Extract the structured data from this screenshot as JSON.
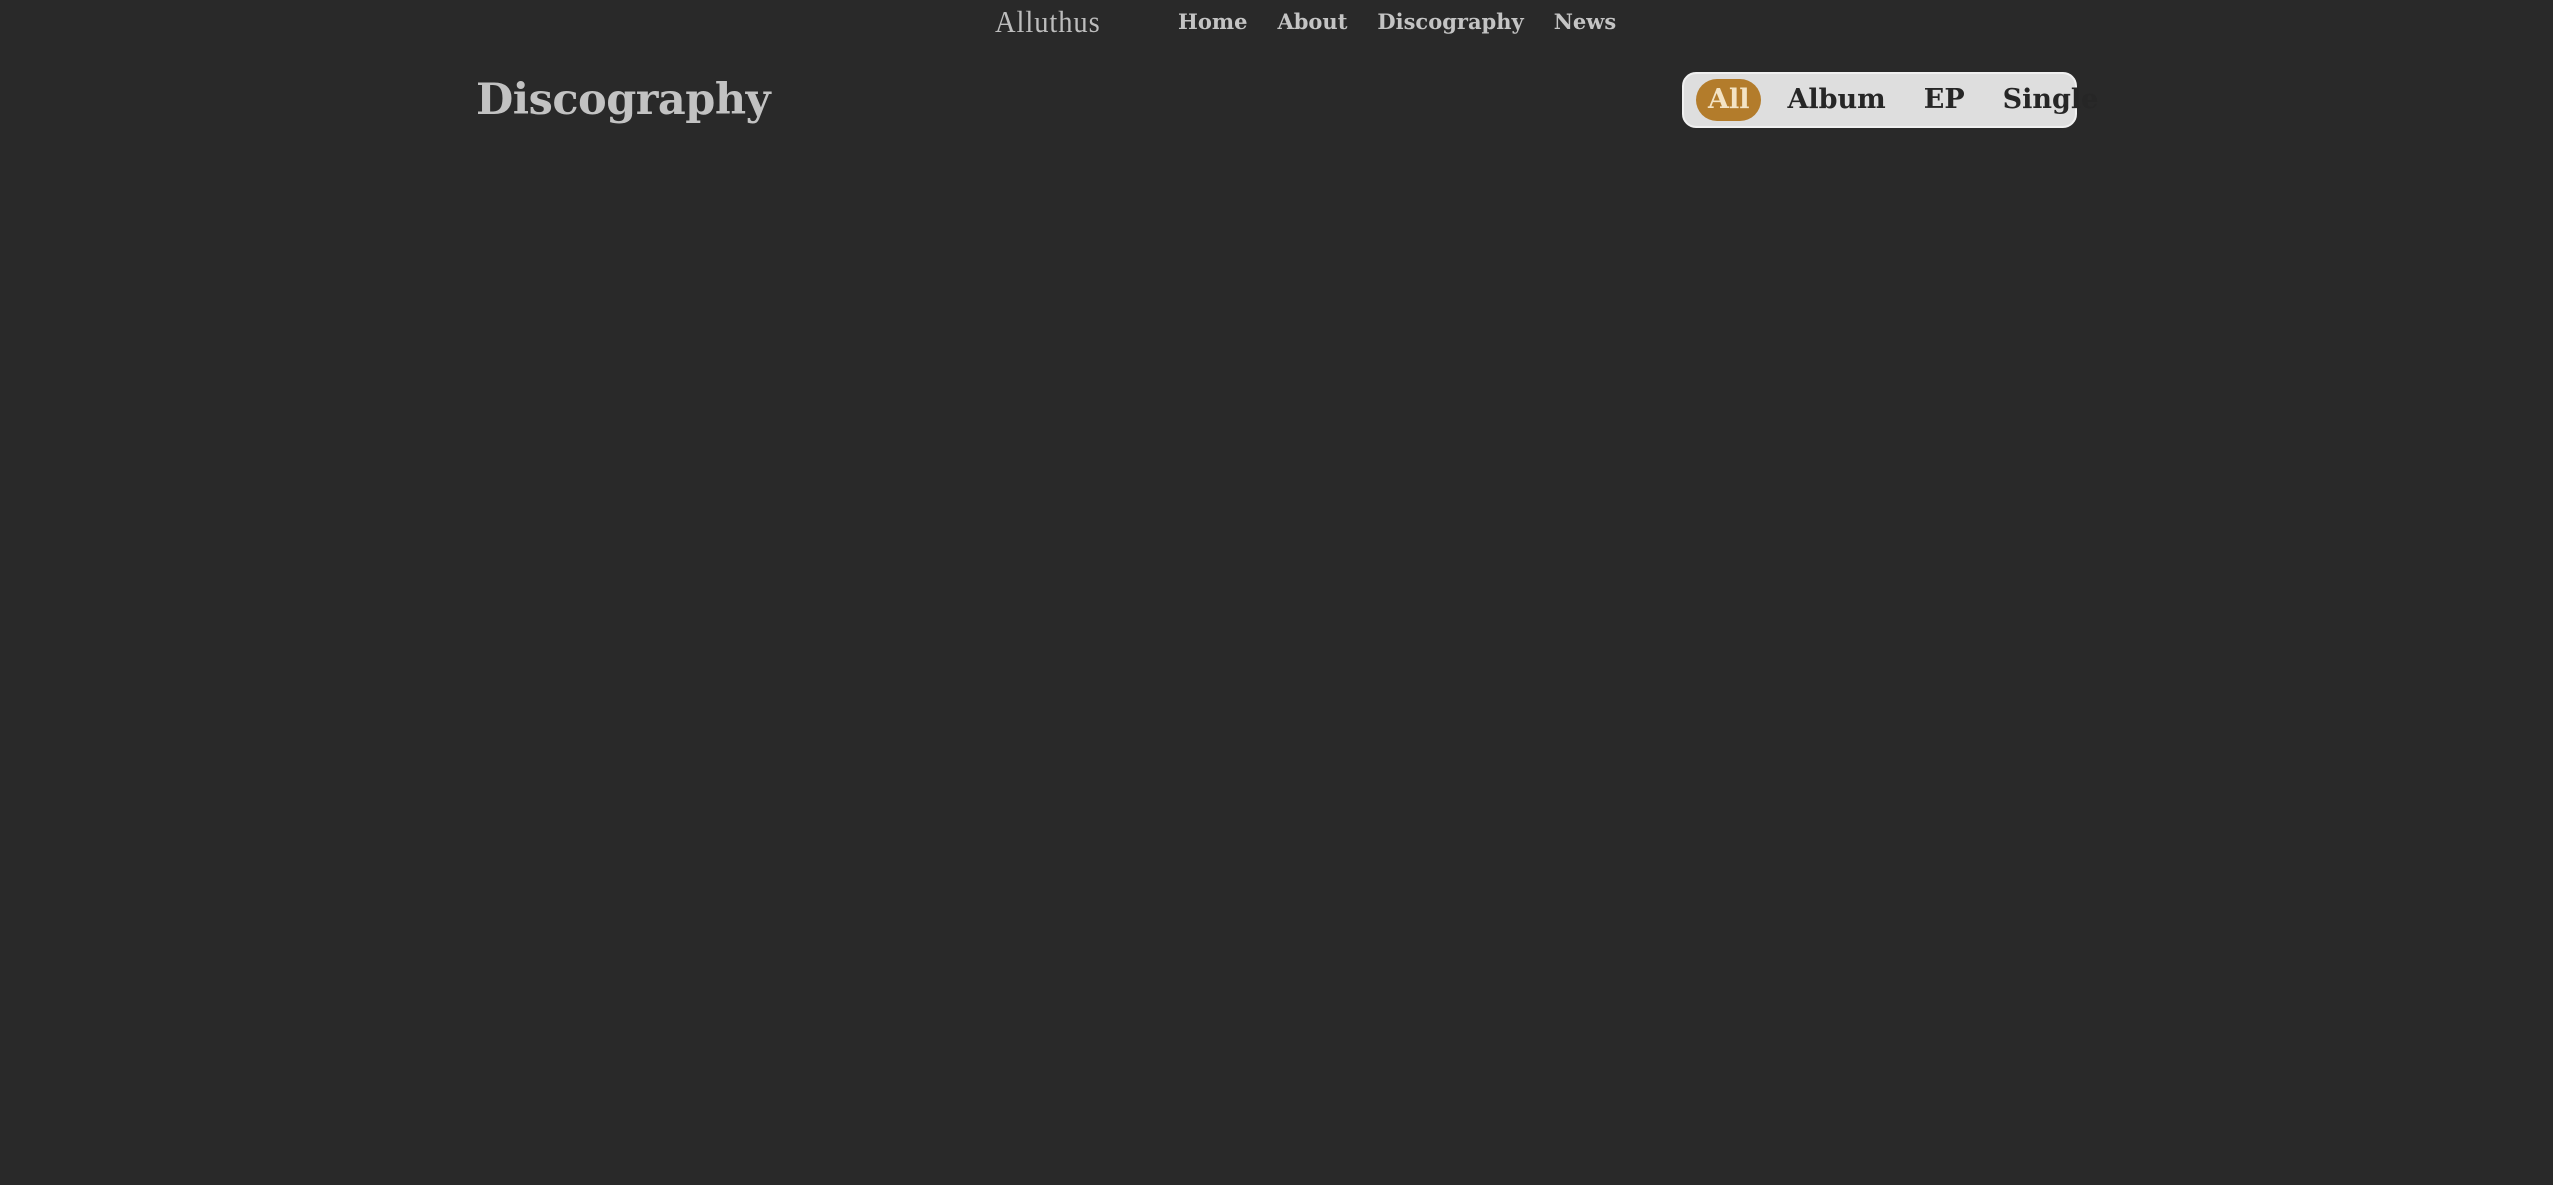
{
  "header": {
    "logo_text": "Alluthus",
    "nav": [
      {
        "label": "Home"
      },
      {
        "label": "About"
      },
      {
        "label": "Discography"
      },
      {
        "label": "News"
      }
    ]
  },
  "main": {
    "title": "Discography",
    "filters": [
      {
        "label": "All",
        "active": true
      },
      {
        "label": "Album",
        "active": false
      },
      {
        "label": "EP",
        "active": false
      },
      {
        "label": "Single",
        "active": false
      }
    ]
  },
  "colors": {
    "background": "#292929",
    "accent": "#b37c2b",
    "filter_bar": "#dedede"
  }
}
